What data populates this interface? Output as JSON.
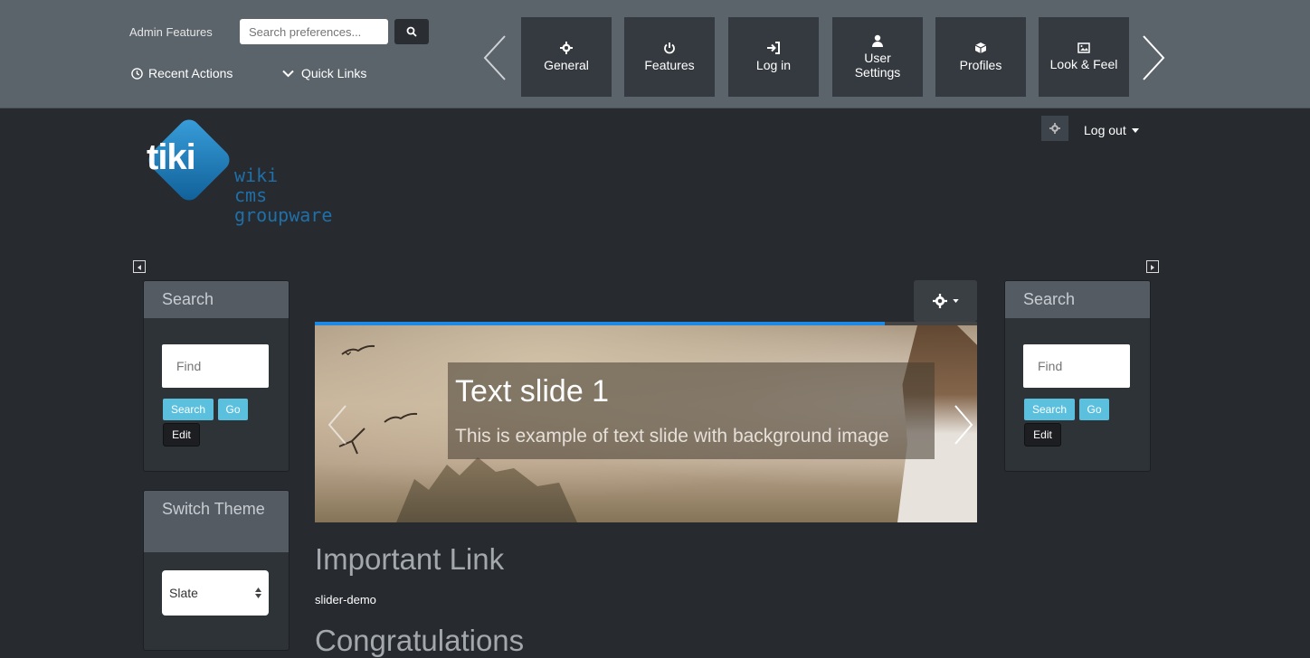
{
  "adminbar": {
    "admin_features": "Admin Features",
    "search_placeholder": "Search preferences...",
    "recent_actions": "Recent Actions",
    "quick_links": "Quick Links",
    "tiles": [
      {
        "label": "General",
        "icon": "gear-icon"
      },
      {
        "label": "Features",
        "icon": "power-icon"
      },
      {
        "label": "Log in",
        "icon": "sign-in-icon"
      },
      {
        "label": "User Settings",
        "icon": "user-icon"
      },
      {
        "label": "Profiles",
        "icon": "cube-icon"
      },
      {
        "label": "Look & Feel",
        "icon": "image-icon"
      }
    ]
  },
  "user": {
    "logout": "Log out"
  },
  "logo": {
    "mark": "tiki",
    "lines": [
      "wiki",
      "cms",
      "groupware"
    ]
  },
  "left": {
    "search": {
      "title": "Search",
      "placeholder": "Find",
      "search_btn": "Search",
      "go_btn": "Go",
      "edit_btn": "Edit"
    },
    "theme": {
      "title": "Switch Theme",
      "value": "Slate"
    }
  },
  "right": {
    "search": {
      "title": "Search",
      "placeholder": "Find",
      "search_btn": "Search",
      "go_btn": "Go",
      "edit_btn": "Edit"
    }
  },
  "slider": {
    "progress": 0.86,
    "title": "Text slide 1",
    "text": "This is example of text slide with background image"
  },
  "content": {
    "heading1": "Important Link",
    "link": "slider-demo",
    "heading2": "Congratulations"
  },
  "colors": {
    "accent": "#1e88e5",
    "info": "#5bc0de",
    "bar": "#5b636b",
    "bg": "#272b30"
  }
}
